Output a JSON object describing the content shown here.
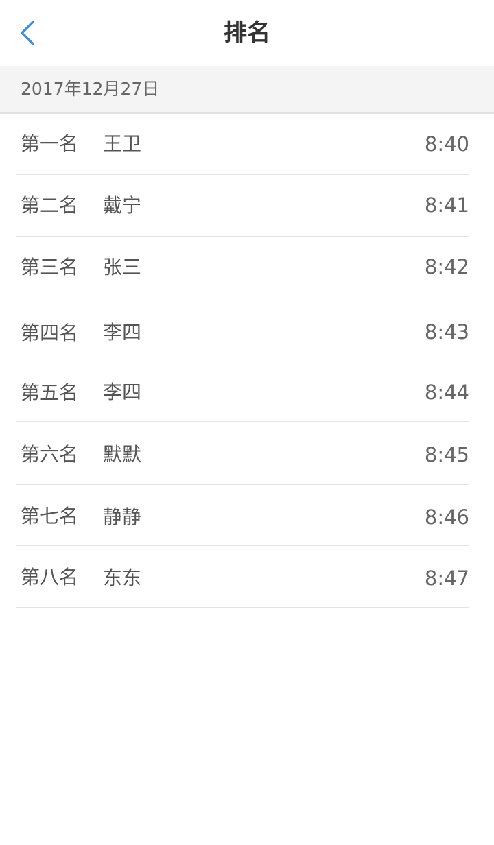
{
  "header": {
    "title": "排名",
    "back_icon": "chevron-left-icon",
    "accent_color": "#3b8ee6"
  },
  "date": "2017年12月27日",
  "rankings": [
    {
      "rank": "第一名",
      "name": "王卫",
      "time": "8:40"
    },
    {
      "rank": "第二名",
      "name": "戴宁",
      "time": "8:41"
    },
    {
      "rank": "第三名",
      "name": "张三",
      "time": "8:42"
    },
    {
      "rank": "第四名",
      "name": "李四",
      "time": "8:43"
    },
    {
      "rank": "第五名",
      "name": "李四",
      "time": "8:44"
    },
    {
      "rank": "第六名",
      "name": "默默",
      "time": "8:45"
    },
    {
      "rank": "第七名",
      "name": "静静",
      "time": "8:46"
    },
    {
      "rank": "第八名",
      "name": "东东",
      "time": "8:47"
    }
  ]
}
